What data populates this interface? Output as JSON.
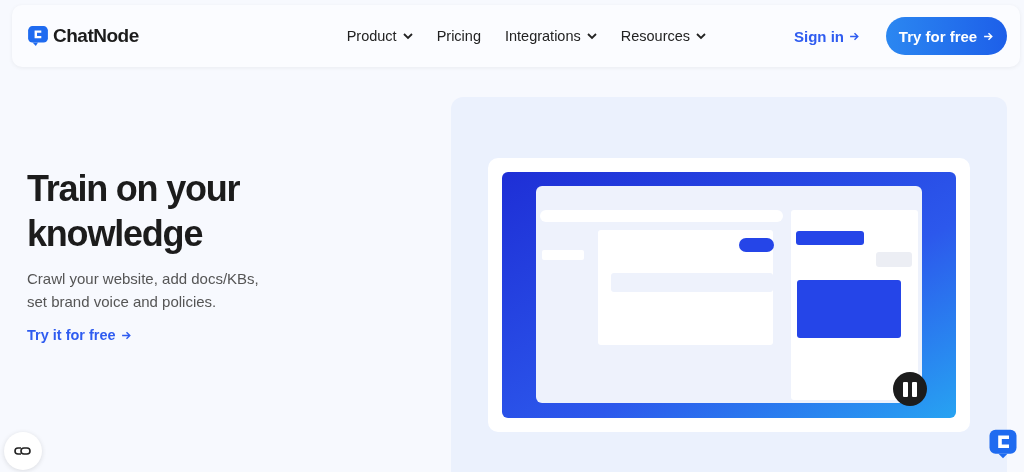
{
  "nav": {
    "logo": "ChatNode",
    "links": [
      {
        "label": "Product",
        "dropdown": true
      },
      {
        "label": "Pricing",
        "dropdown": false
      },
      {
        "label": "Integrations",
        "dropdown": true
      },
      {
        "label": "Resources",
        "dropdown": true
      }
    ],
    "sign_in": "Sign in",
    "cta": "Try for free"
  },
  "hero": {
    "title": "Train on your knowledge",
    "description": "Crawl your website, add docs/KBs, set brand voice and policies.",
    "link": "Try it for free"
  }
}
